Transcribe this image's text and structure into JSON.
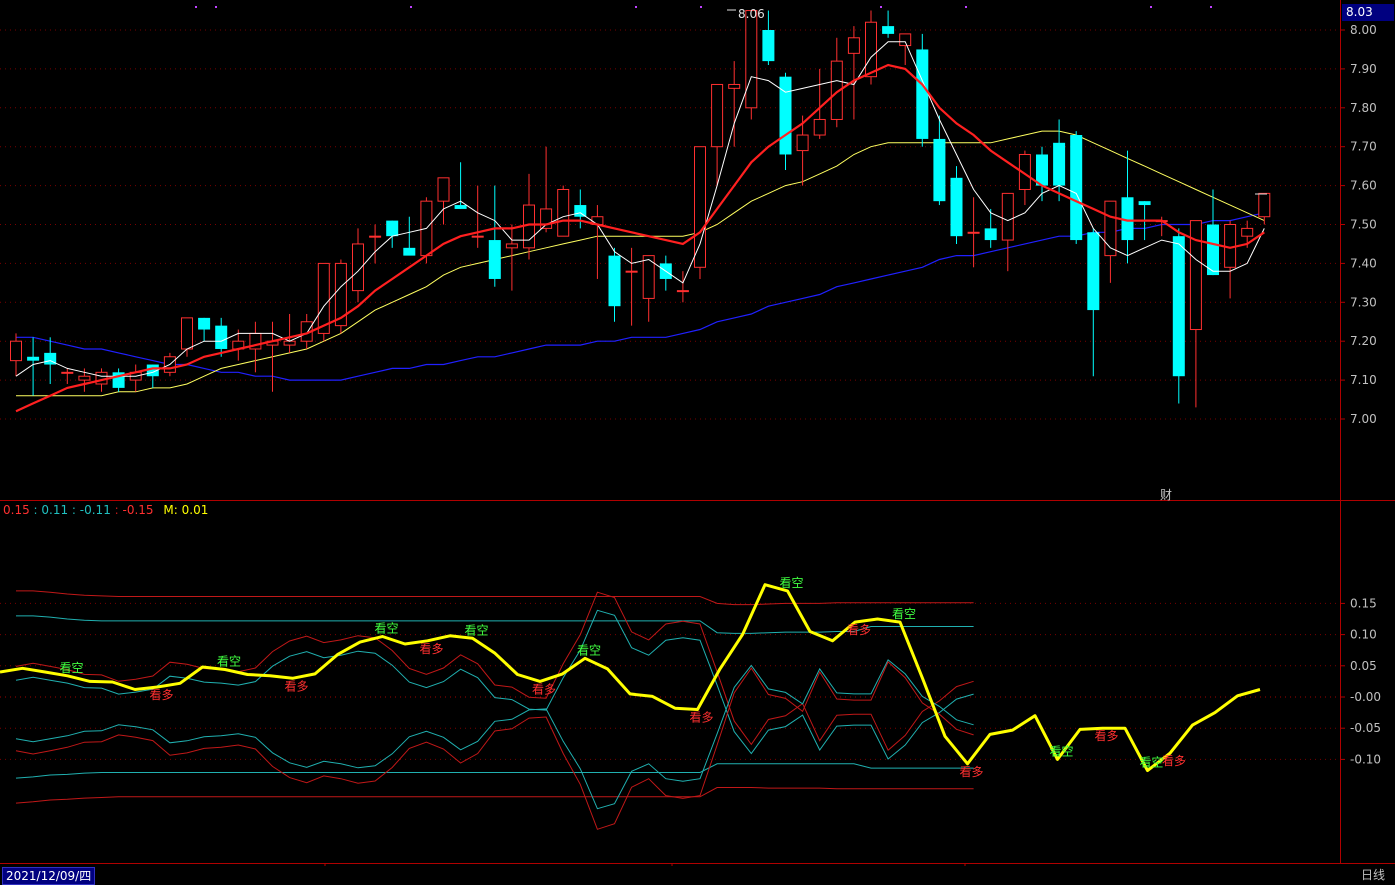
{
  "main_price_box": "8.03",
  "peak_label": "8.06",
  "fin_marker": "财",
  "date_label": "2021/12/09/四",
  "period_label": "日线",
  "legend": {
    "v1": "0.15",
    "v2": "0.11",
    "v3": "-0.11",
    "v4": "-0.15",
    "m_label": "M:",
    "m_value": "0.01",
    "sep": " : "
  },
  "colors": {
    "up": "#ff3030",
    "down": "#00ffff",
    "ma_white": "#ffffff",
    "ma_red": "#ff2020",
    "ma_yellow": "#ffff60",
    "ma_blue": "#2020ff",
    "signal_yellow": "#ffff00",
    "band_red": "#c01818",
    "band_cyan": "#20b0b0",
    "axis_red": "#b00000",
    "text_kanduo": "#ff3030",
    "text_kankong": "#40ff40"
  },
  "chart_data": [
    {
      "type": "candlestick",
      "ylim": [
        6.93,
        8.09
      ],
      "yticks": [
        "8.00",
        "7.90",
        "7.80",
        "7.70",
        "7.60",
        "7.50",
        "7.40",
        "7.30",
        "7.20",
        "7.10",
        "7.00"
      ],
      "xticks": [
        "1",
        "2",
        "3"
      ],
      "candles": [
        [
          7.15,
          7.22,
          7.11,
          7.2
        ],
        [
          7.16,
          7.21,
          7.06,
          7.15
        ],
        [
          7.17,
          7.21,
          7.09,
          7.14
        ],
        [
          7.12,
          7.13,
          7.09,
          7.12
        ],
        [
          7.1,
          7.13,
          7.07,
          7.11
        ],
        [
          7.09,
          7.13,
          7.07,
          7.12
        ],
        [
          7.12,
          7.13,
          7.07,
          7.08
        ],
        [
          7.1,
          7.14,
          7.07,
          7.12
        ],
        [
          7.14,
          7.14,
          7.08,
          7.11
        ],
        [
          7.12,
          7.17,
          7.11,
          7.16
        ],
        [
          7.18,
          7.26,
          7.16,
          7.26
        ],
        [
          7.26,
          7.26,
          7.2,
          7.23
        ],
        [
          7.24,
          7.26,
          7.16,
          7.18
        ],
        [
          7.18,
          7.23,
          7.15,
          7.2
        ],
        [
          7.18,
          7.25,
          7.12,
          7.22
        ],
        [
          7.19,
          7.25,
          7.07,
          7.2
        ],
        [
          7.19,
          7.27,
          7.17,
          7.2
        ],
        [
          7.2,
          7.27,
          7.18,
          7.25
        ],
        [
          7.22,
          7.4,
          7.2,
          7.4
        ],
        [
          7.24,
          7.41,
          7.22,
          7.4
        ],
        [
          7.33,
          7.49,
          7.3,
          7.45
        ],
        [
          7.47,
          7.5,
          7.4,
          7.47
        ],
        [
          7.51,
          7.51,
          7.44,
          7.47
        ],
        [
          7.44,
          7.52,
          7.43,
          7.42
        ],
        [
          7.42,
          7.57,
          7.4,
          7.56
        ],
        [
          7.56,
          7.61,
          7.5,
          7.62
        ],
        [
          7.55,
          7.66,
          7.54,
          7.54
        ],
        [
          7.47,
          7.6,
          7.44,
          7.47
        ],
        [
          7.46,
          7.6,
          7.34,
          7.36
        ],
        [
          7.44,
          7.5,
          7.33,
          7.45
        ],
        [
          7.44,
          7.63,
          7.41,
          7.55
        ],
        [
          7.49,
          7.7,
          7.48,
          7.54
        ],
        [
          7.47,
          7.6,
          7.47,
          7.59
        ],
        [
          7.55,
          7.59,
          7.49,
          7.52
        ],
        [
          7.5,
          7.55,
          7.36,
          7.52
        ],
        [
          7.42,
          7.44,
          7.25,
          7.29
        ],
        [
          7.38,
          7.44,
          7.24,
          7.38
        ],
        [
          7.31,
          7.4,
          7.25,
          7.42
        ],
        [
          7.4,
          7.42,
          7.33,
          7.36
        ],
        [
          7.33,
          7.38,
          7.3,
          7.33
        ],
        [
          7.39,
          7.7,
          7.36,
          7.7
        ],
        [
          7.7,
          7.78,
          7.6,
          7.86
        ],
        [
          7.85,
          7.92,
          7.7,
          7.86
        ],
        [
          7.8,
          8.05,
          7.77,
          8.05
        ],
        [
          8.0,
          8.05,
          7.91,
          7.92
        ],
        [
          7.88,
          7.89,
          7.64,
          7.68
        ],
        [
          7.69,
          7.78,
          7.6,
          7.73
        ],
        [
          7.73,
          7.9,
          7.72,
          7.77
        ],
        [
          7.77,
          7.98,
          7.75,
          7.92
        ],
        [
          7.94,
          8.01,
          7.77,
          7.98
        ],
        [
          7.88,
          8.05,
          7.86,
          8.02
        ],
        [
          8.01,
          8.05,
          7.98,
          7.99
        ],
        [
          7.96,
          7.99,
          7.91,
          7.99
        ],
        [
          7.95,
          7.99,
          7.7,
          7.72
        ],
        [
          7.72,
          7.78,
          7.55,
          7.56
        ],
        [
          7.62,
          7.65,
          7.45,
          7.47
        ],
        [
          7.48,
          7.57,
          7.39,
          7.48
        ],
        [
          7.49,
          7.54,
          7.44,
          7.46
        ],
        [
          7.46,
          7.56,
          7.38,
          7.58
        ],
        [
          7.59,
          7.69,
          7.55,
          7.68
        ],
        [
          7.68,
          7.7,
          7.56,
          7.6
        ],
        [
          7.71,
          7.77,
          7.56,
          7.6
        ],
        [
          7.73,
          7.74,
          7.45,
          7.46
        ],
        [
          7.48,
          7.49,
          7.11,
          7.28
        ],
        [
          7.42,
          7.55,
          7.35,
          7.56
        ],
        [
          7.57,
          7.69,
          7.4,
          7.46
        ],
        [
          7.56,
          7.56,
          7.46,
          7.55
        ],
        [
          7.51,
          7.52,
          7.47,
          7.51
        ],
        [
          7.47,
          7.49,
          7.04,
          7.11
        ],
        [
          7.23,
          7.45,
          7.03,
          7.51
        ],
        [
          7.5,
          7.59,
          7.37,
          7.37
        ],
        [
          7.39,
          7.51,
          7.31,
          7.5
        ],
        [
          7.47,
          7.51,
          7.44,
          7.49
        ],
        [
          7.52,
          7.58,
          7.5,
          7.58
        ]
      ],
      "ma_white": [
        7.11,
        7.14,
        7.15,
        7.13,
        7.12,
        7.11,
        7.11,
        7.11,
        7.12,
        7.14,
        7.18,
        7.2,
        7.2,
        7.22,
        7.22,
        7.22,
        7.2,
        7.22,
        7.29,
        7.34,
        7.38,
        7.43,
        7.47,
        7.48,
        7.49,
        7.54,
        7.56,
        7.53,
        7.51,
        7.46,
        7.46,
        7.5,
        7.52,
        7.53,
        7.5,
        7.43,
        7.4,
        7.41,
        7.38,
        7.35,
        7.45,
        7.6,
        7.76,
        7.88,
        7.87,
        7.84,
        7.85,
        7.86,
        7.87,
        7.86,
        7.93,
        7.97,
        7.97,
        7.87,
        7.77,
        7.68,
        7.59,
        7.53,
        7.51,
        7.53,
        7.58,
        7.6,
        7.58,
        7.49,
        7.44,
        7.42,
        7.44,
        7.46,
        7.45,
        7.41,
        7.38,
        7.38,
        7.4,
        7.49
      ],
      "ma_red": [
        7.02,
        7.04,
        7.06,
        7.08,
        7.09,
        7.1,
        7.11,
        7.12,
        7.13,
        7.13,
        7.14,
        7.16,
        7.17,
        7.18,
        7.19,
        7.2,
        7.21,
        7.22,
        7.24,
        7.26,
        7.29,
        7.33,
        7.36,
        7.39,
        7.42,
        7.45,
        7.47,
        7.48,
        7.49,
        7.49,
        7.5,
        7.5,
        7.51,
        7.51,
        7.5,
        7.49,
        7.48,
        7.47,
        7.46,
        7.45,
        7.48,
        7.54,
        7.6,
        7.66,
        7.7,
        7.73,
        7.76,
        7.8,
        7.84,
        7.87,
        7.89,
        7.91,
        7.9,
        7.86,
        7.8,
        7.76,
        7.73,
        7.69,
        7.66,
        7.63,
        7.6,
        7.58,
        7.56,
        7.54,
        7.52,
        7.51,
        7.51,
        7.51,
        7.48,
        7.46,
        7.45,
        7.44,
        7.45,
        7.48
      ],
      "ma_yellow": [
        7.06,
        7.06,
        7.06,
        7.06,
        7.06,
        7.06,
        7.07,
        7.07,
        7.08,
        7.08,
        7.09,
        7.11,
        7.13,
        7.14,
        7.15,
        7.16,
        7.17,
        7.18,
        7.2,
        7.22,
        7.25,
        7.28,
        7.3,
        7.32,
        7.34,
        7.37,
        7.39,
        7.4,
        7.41,
        7.42,
        7.43,
        7.44,
        7.45,
        7.46,
        7.47,
        7.47,
        7.47,
        7.47,
        7.47,
        7.47,
        7.48,
        7.5,
        7.53,
        7.56,
        7.58,
        7.6,
        7.61,
        7.63,
        7.65,
        7.68,
        7.7,
        7.71,
        7.71,
        7.71,
        7.71,
        7.71,
        7.71,
        7.71,
        7.72,
        7.73,
        7.74,
        7.74,
        7.73,
        7.71,
        7.69,
        7.67,
        7.65,
        7.63,
        7.61,
        7.59,
        7.57,
        7.55,
        7.53,
        7.51
      ],
      "ma_blue": [
        7.21,
        7.21,
        7.2,
        7.19,
        7.18,
        7.18,
        7.17,
        7.16,
        7.15,
        7.14,
        7.14,
        7.13,
        7.12,
        7.12,
        7.11,
        7.11,
        7.1,
        7.1,
        7.1,
        7.1,
        7.11,
        7.12,
        7.13,
        7.13,
        7.14,
        7.14,
        7.15,
        7.16,
        7.16,
        7.17,
        7.18,
        7.19,
        7.19,
        7.19,
        7.2,
        7.2,
        7.21,
        7.21,
        7.21,
        7.22,
        7.23,
        7.25,
        7.26,
        7.27,
        7.29,
        7.3,
        7.31,
        7.32,
        7.34,
        7.35,
        7.36,
        7.37,
        7.38,
        7.39,
        7.41,
        7.42,
        7.42,
        7.43,
        7.44,
        7.45,
        7.46,
        7.47,
        7.47,
        7.48,
        7.48,
        7.49,
        7.49,
        7.5,
        7.5,
        7.5,
        7.51,
        7.51,
        7.52,
        7.53
      ]
    },
    {
      "type": "line",
      "ylim": [
        -0.178,
        0.19
      ],
      "yticks": [
        "0.15",
        "0.10",
        "0.05",
        "-0.00",
        "-0.05",
        "-0.10"
      ],
      "series": [
        {
          "name": "M",
          "values": [
            0.04,
            0.046,
            0.04,
            0.034,
            0.025,
            0.024,
            0.012,
            0.016,
            0.022,
            0.048,
            0.044,
            0.036,
            0.034,
            0.03,
            0.037,
            0.068,
            0.088,
            0.097,
            0.085,
            0.09,
            0.098,
            0.094,
            0.07,
            0.036,
            0.025,
            0.037,
            0.062,
            0.045,
            0.005,
            0.001,
            -0.018,
            -0.02,
            0.045,
            0.1,
            0.18,
            0.17,
            0.105,
            0.09,
            0.12,
            0.125,
            0.12,
            0.03,
            -0.063,
            -0.107,
            -0.06,
            -0.053,
            -0.03,
            -0.1,
            -0.052,
            -0.05,
            -0.05,
            -0.118,
            -0.09,
            -0.045,
            -0.025,
            0.002,
            0.012
          ]
        },
        {
          "name": "up-outer",
          "values": [
            0.17,
            0.17,
            0.168,
            0.165,
            0.163,
            0.162,
            0.161,
            0.161,
            0.161,
            0.161,
            0.161,
            0.161,
            0.161,
            0.161,
            0.161,
            0.161,
            0.161,
            0.161,
            0.161,
            0.161,
            0.161,
            0.161,
            0.161,
            0.161,
            0.161,
            0.161,
            0.161,
            0.161,
            0.161,
            0.161,
            0.161,
            0.161,
            0.161,
            0.161,
            0.161,
            0.161,
            0.161,
            0.161,
            0.161,
            0.161,
            0.161,
            0.15,
            0.148,
            0.148,
            0.149,
            0.15,
            0.15,
            0.15,
            0.151,
            0.151,
            0.151,
            0.151,
            0.151,
            0.151,
            0.151,
            0.151,
            0.151
          ]
        },
        {
          "name": "up-inner",
          "values": [
            0.13,
            0.13,
            0.128,
            0.125,
            0.123,
            0.122,
            0.122,
            0.122,
            0.122,
            0.122,
            0.122,
            0.122,
            0.122,
            0.122,
            0.122,
            0.122,
            0.122,
            0.122,
            0.122,
            0.122,
            0.122,
            0.122,
            0.122,
            0.122,
            0.122,
            0.122,
            0.122,
            0.122,
            0.122,
            0.122,
            0.122,
            0.122,
            0.122,
            0.122,
            0.122,
            0.122,
            0.122,
            0.122,
            0.122,
            0.122,
            0.122,
            0.103,
            0.102,
            0.102,
            0.103,
            0.104,
            0.104,
            0.104,
            0.105,
            0.105,
            0.113,
            0.113,
            0.113,
            0.113,
            0.113,
            0.113,
            0.113
          ]
        },
        {
          "name": "lo-inner",
          "values": [
            -0.13,
            -0.128,
            -0.125,
            -0.124,
            -0.122,
            -0.121,
            -0.121,
            -0.121,
            -0.121,
            -0.121,
            -0.121,
            -0.121,
            -0.121,
            -0.121,
            -0.121,
            -0.121,
            -0.121,
            -0.121,
            -0.121,
            -0.121,
            -0.121,
            -0.121,
            -0.121,
            -0.121,
            -0.121,
            -0.121,
            -0.121,
            -0.121,
            -0.121,
            -0.121,
            -0.121,
            -0.121,
            -0.121,
            -0.121,
            -0.121,
            -0.121,
            -0.121,
            -0.121,
            -0.121,
            -0.121,
            -0.121,
            -0.107,
            -0.107,
            -0.107,
            -0.107,
            -0.107,
            -0.107,
            -0.107,
            -0.107,
            -0.107,
            -0.114,
            -0.114,
            -0.114,
            -0.114,
            -0.114,
            -0.114,
            -0.114
          ]
        },
        {
          "name": "lo-outer",
          "values": [
            -0.17,
            -0.168,
            -0.165,
            -0.164,
            -0.162,
            -0.161,
            -0.16,
            -0.16,
            -0.16,
            -0.16,
            -0.16,
            -0.16,
            -0.16,
            -0.16,
            -0.16,
            -0.16,
            -0.16,
            -0.16,
            -0.16,
            -0.16,
            -0.16,
            -0.16,
            -0.16,
            -0.16,
            -0.16,
            -0.16,
            -0.16,
            -0.16,
            -0.16,
            -0.16,
            -0.16,
            -0.16,
            -0.16,
            -0.16,
            -0.16,
            -0.16,
            -0.16,
            -0.16,
            -0.16,
            -0.16,
            -0.16,
            -0.145,
            -0.145,
            -0.145,
            -0.146,
            -0.146,
            -0.146,
            -0.146,
            -0.147,
            -0.147,
            -0.147,
            -0.147,
            -0.147,
            -0.147,
            -0.147,
            -0.147,
            -0.147
          ]
        }
      ],
      "signals": [
        {
          "idx": 3,
          "text": "看空",
          "kind": "kong"
        },
        {
          "idx": 7,
          "text": "看多",
          "kind": "duo"
        },
        {
          "idx": 10,
          "text": "看空",
          "kind": "kong"
        },
        {
          "idx": 13,
          "text": "看多",
          "kind": "duo"
        },
        {
          "idx": 17,
          "text": "看空",
          "kind": "kong"
        },
        {
          "idx": 19,
          "text": "看多",
          "kind": "duo"
        },
        {
          "idx": 21,
          "text": "看空",
          "kind": "kong"
        },
        {
          "idx": 24,
          "text": "看多",
          "kind": "duo"
        },
        {
          "idx": 26,
          "text": "看空",
          "kind": "kong"
        },
        {
          "idx": 31,
          "text": "看多",
          "kind": "duo"
        },
        {
          "idx": 35,
          "text": "看空",
          "kind": "kong"
        },
        {
          "idx": 38,
          "text": "看多",
          "kind": "duo"
        },
        {
          "idx": 40,
          "text": "看空",
          "kind": "kong"
        },
        {
          "idx": 43,
          "text": "看多",
          "kind": "duo"
        },
        {
          "idx": 47,
          "text": "看空",
          "kind": "kong"
        },
        {
          "idx": 49,
          "text": "看多",
          "kind": "duo"
        },
        {
          "idx": 51,
          "text": "看空",
          "kind": "kong"
        },
        {
          "idx": 52,
          "text": "看多",
          "kind": "duo"
        }
      ]
    }
  ]
}
